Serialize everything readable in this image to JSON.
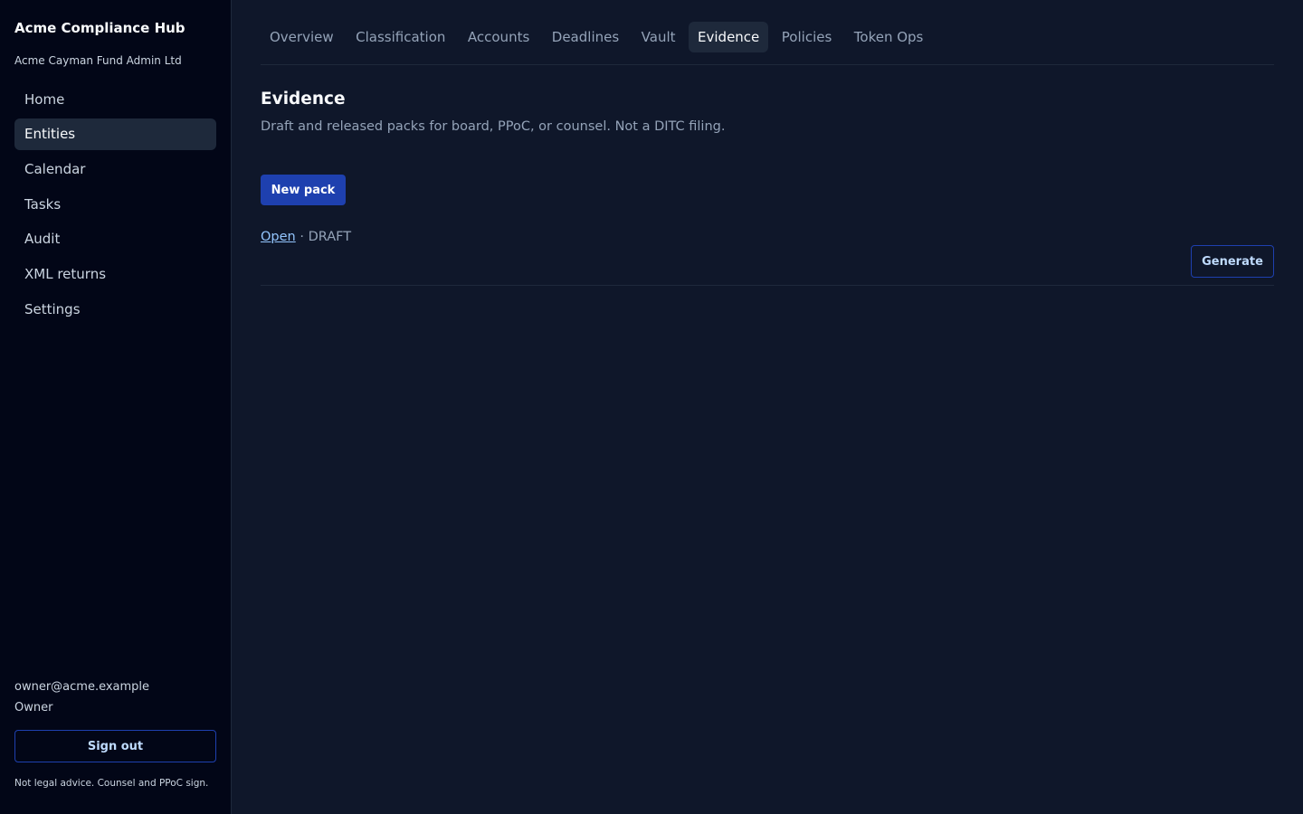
{
  "sidebar": {
    "app_title": "Acme Compliance Hub",
    "org_name": "Acme Cayman Fund Admin Ltd",
    "nav": [
      {
        "label": "Home",
        "active": false
      },
      {
        "label": "Entities",
        "active": true
      },
      {
        "label": "Calendar",
        "active": false
      },
      {
        "label": "Tasks",
        "active": false
      },
      {
        "label": "Audit",
        "active": false
      },
      {
        "label": "XML returns",
        "active": false
      },
      {
        "label": "Settings",
        "active": false
      }
    ],
    "user_email": "owner@acme.example",
    "user_role": "Owner",
    "signout_label": "Sign out",
    "disclaimer": "Not legal advice. Counsel and PPoC sign."
  },
  "tabs": [
    {
      "label": "Overview",
      "active": false
    },
    {
      "label": "Classification",
      "active": false
    },
    {
      "label": "Accounts",
      "active": false
    },
    {
      "label": "Deadlines",
      "active": false
    },
    {
      "label": "Vault",
      "active": false
    },
    {
      "label": "Evidence",
      "active": true
    },
    {
      "label": "Policies",
      "active": false
    },
    {
      "label": "Token Ops",
      "active": false
    }
  ],
  "main": {
    "title": "Evidence",
    "subtitle": "Draft and released packs for board, PPoC, or counsel. Not a DITC filing.",
    "new_pack_label": "New pack",
    "pack": {
      "link_label": "Open",
      "separator": " · ",
      "status": "DRAFT",
      "generate_label": "Generate"
    }
  },
  "colors": {
    "background": "#0f172a",
    "sidebar": "#020617",
    "accent": "#1e40af",
    "active_item": "#1e293b"
  }
}
